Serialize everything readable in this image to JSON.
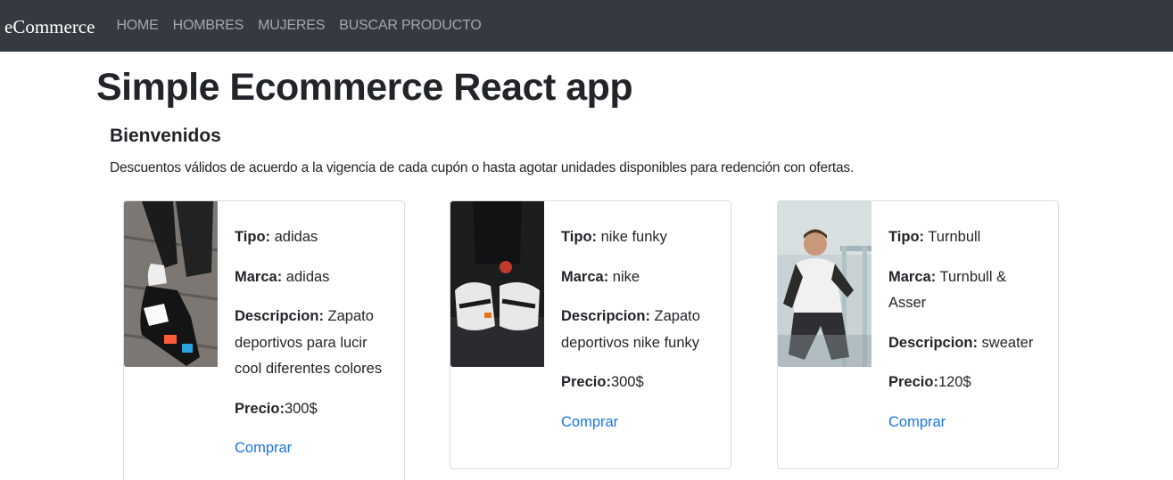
{
  "nav": {
    "brand": "eCommerce",
    "links": [
      "HOME",
      "HOMBRES",
      "MUJERES",
      "BUSCAR PRODUCTO"
    ]
  },
  "header": {
    "title": "Simple Ecommerce React app",
    "subtitle": "Bienvenidos",
    "description": "Descuentos válidos de acuerdo a la vigencia de cada cupón o hasta agotar unidades disponibles para redención con ofertas."
  },
  "labels": {
    "tipo": "Tipo:",
    "marca": "Marca:",
    "descripcion": "Descripcion:",
    "precio": "Precio:"
  },
  "products": [
    {
      "tipo": "adidas",
      "marca": "adidas",
      "descripcion": "Zapato deportivos para lucir cool diferentes colores",
      "precio": "300$",
      "action": "Comprar",
      "image_icon": "sneaker-photo-icon"
    },
    {
      "tipo": "nike funky",
      "marca": "nike",
      "descripcion": "Zapato deportivos nike funky",
      "precio": "300$",
      "action": "Comprar",
      "image_icon": "sneaker-photo-icon"
    },
    {
      "tipo": "Turnbull",
      "marca": "Turnbull & Asser",
      "descripcion": "sweater",
      "precio": "120$",
      "action": "Comprar",
      "image_icon": "person-photo-icon"
    }
  ],
  "colors": {
    "navbar": "#343a40",
    "link": "#1a73e8"
  }
}
